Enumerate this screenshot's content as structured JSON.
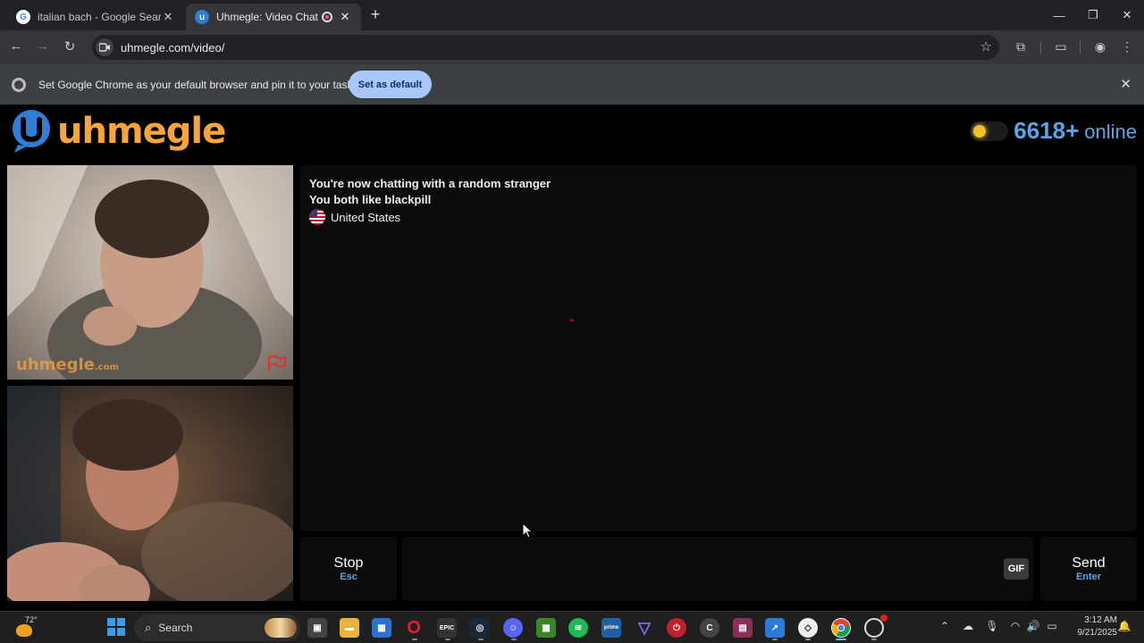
{
  "browser": {
    "tabs": [
      {
        "title": "italian bach - Google Search",
        "active": false
      },
      {
        "title": "Uhmegle: Video Chat | Ome",
        "active": true
      }
    ],
    "url": "uhmegle.com/video/",
    "infobar": {
      "message": "Set Google Chrome as your default browser and pin it to your taskbar",
      "button": "Set as default"
    }
  },
  "site": {
    "logo_text": "uhmegle",
    "online_count": "6618+",
    "online_label": "online",
    "video_watermark": "uhmegle",
    "video_watermark_suffix": ".com"
  },
  "chat": {
    "messages": [
      "You're now chatting with a random stranger",
      "You both like blackpill"
    ],
    "country": "United States",
    "input_value": "",
    "stop_label": "Stop",
    "stop_key": "Esc",
    "gif_label": "GIF",
    "send_label": "Send",
    "send_key": "Enter"
  },
  "taskbar": {
    "weather_temp": "72°",
    "search_label": "Search",
    "time": "3:12 AM",
    "date": "9/21/2025",
    "apps": [
      "file-explorer",
      "microsoft-store",
      "opera",
      "epic-games",
      "steam",
      "discord",
      "minecraft",
      "spotify",
      "prime-video",
      "proton-vpn",
      "power",
      "app-ch",
      "winrar",
      "rdp",
      "app-circle",
      "chrome",
      "app-badge"
    ]
  },
  "colors": {
    "accent_orange": "#f7a43b",
    "accent_blue": "#58a6e8",
    "chat_bg": "#0b0b0b"
  }
}
